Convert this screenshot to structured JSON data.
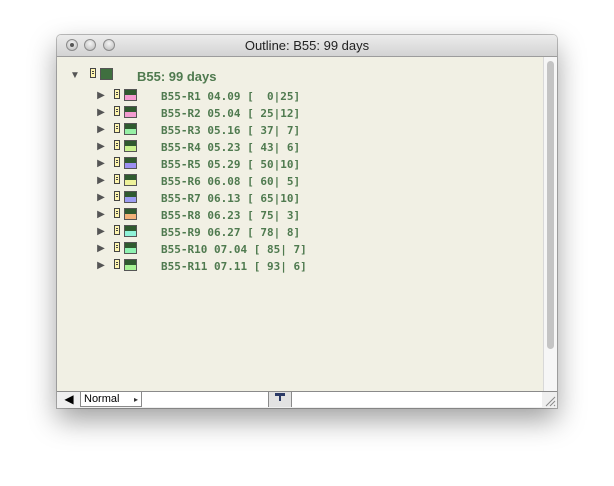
{
  "window": {
    "title": "Outline: B55: 99 days"
  },
  "outline": {
    "root": {
      "label": "B55: 99 days",
      "expanded": true,
      "swatch_color": "#3f6f3f"
    },
    "items": [
      {
        "label": "B55-R1 04.09 [  0|25]",
        "color": "#f59bd0"
      },
      {
        "label": "B55-R2 05.04 [ 25|12]",
        "color": "#f29bd0"
      },
      {
        "label": "B55-R3 05.16 [ 37| 7]",
        "color": "#97f0a6"
      },
      {
        "label": "B55-R4 05.23 [ 43| 6]",
        "color": "#c9f28f"
      },
      {
        "label": "B55-R5 05.29 [ 50|10]",
        "color": "#9c8ff2"
      },
      {
        "label": "B55-R6 06.08 [ 60| 5]",
        "color": "#eef29a"
      },
      {
        "label": "B55-R7 06.13 [ 65|10]",
        "color": "#9c9cf2"
      },
      {
        "label": "B55-R8 06.23 [ 75| 3]",
        "color": "#f2b27a"
      },
      {
        "label": "B55-R9 06.27 [ 78| 8]",
        "color": "#8ff2d8"
      },
      {
        "label": "B55-R10 07.04 [ 85| 7]",
        "color": "#8ff2b2"
      },
      {
        "label": "B55-R11 07.11 [ 93| 6]",
        "color": "#a6f294"
      }
    ]
  },
  "bottombar": {
    "back_icon": "left-arrow-icon",
    "mode_label": "Normal",
    "mode_arrow": "▸",
    "pin_icon": "pin-icon"
  },
  "icons": {
    "expand": "▶",
    "collapse": "▼",
    "back": "◀"
  }
}
